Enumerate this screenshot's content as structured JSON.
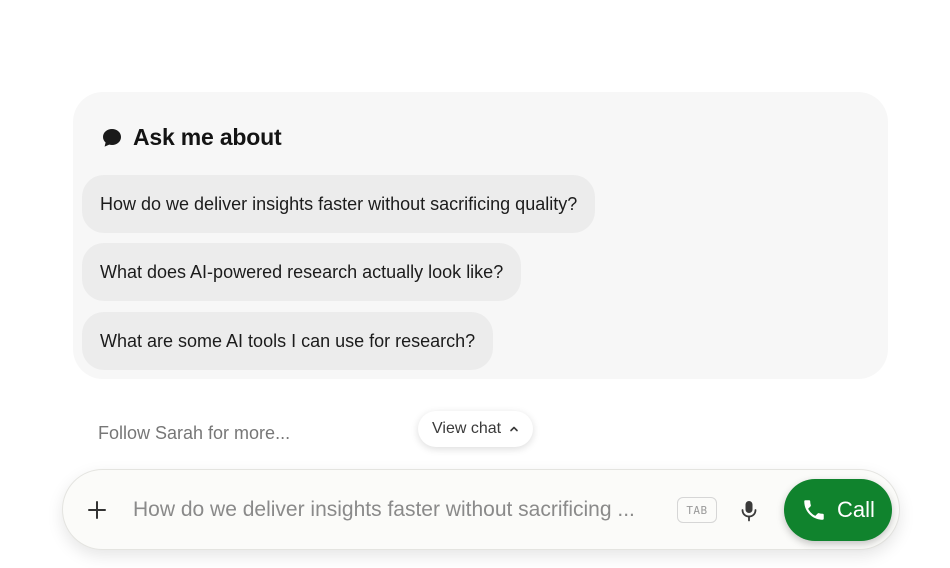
{
  "ask_card": {
    "title": "Ask me about",
    "icon": "chat-bubble-icon",
    "suggestions": [
      "How do we deliver insights faster without sacrificing quality?",
      "What does AI-powered research actually look like?",
      "What are some AI tools I can use for research?"
    ]
  },
  "footer": {
    "follow_text": "Follow Sarah for more...",
    "view_chat_label": "View chat",
    "view_chat_icon": "chevron-up-icon"
  },
  "input_bar": {
    "plus_icon": "plus-icon",
    "placeholder": "How do we deliver insights faster without sacrificing ...",
    "tab_hint": "TAB",
    "mic_icon": "microphone-icon",
    "call_label": "Call",
    "call_icon": "phone-icon"
  },
  "colors": {
    "call_button": "#10832d",
    "card_background": "#f7f7f7",
    "chip_background": "#ececec"
  }
}
